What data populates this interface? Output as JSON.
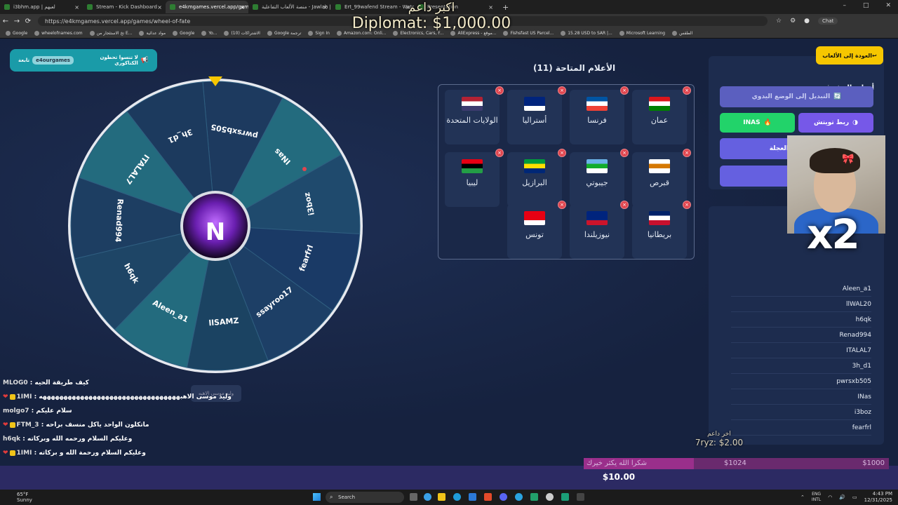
{
  "browser": {
    "tabs": [
      {
        "title": "i3bhm.app | لعبهم",
        "active": false
      },
      {
        "title": "Stream - Kick Dashboard",
        "active": false
      },
      {
        "title": "e4kmgames.vercel.app/games/wh...",
        "active": true
      },
      {
        "title": "منصة الألعاب التفاعلية - Jawlah | جولة",
        "active": false
      },
      {
        "title": "Ert_99wafend Stream - Watch L...",
        "active": false
      },
      {
        "title": "Presentation",
        "active": false
      }
    ],
    "new_tab": "+",
    "url": "https://e4kmgames.vercel.app/games/wheel-of-fate",
    "chat_label": "Chat",
    "bookmarks": [
      "Google",
      "wheelofnames.com",
      "تخ الاستئجار من E...",
      "مواد عدائية",
      "Google",
      "Yo...",
      "(10) الاشتراكات",
      "Google ترجمة",
      "Sign In",
      "Amazon.com: Onli...",
      "Electronics, Cars, F...",
      "AliExpress - موقع...",
      "Fishsfast US Parcel...",
      "15.28 USD to SAR |...",
      "Microsoft Learning",
      "الطقس"
    ]
  },
  "overlay": {
    "donor_line1": "اكبر داعم",
    "donor_line2": "Diplomat: $1,000.00",
    "x2": "x2",
    "last_donor_label": "اخر داعم",
    "last_donor_value": "7ryz: $2.00",
    "goal_left_text": "شكرا الله يكثر خيرك",
    "goal_mid": "$1024",
    "goal_right": "$1000",
    "goal_fill_fraction": 0.36,
    "total": "$10.00"
  },
  "notice": {
    "text": "لا تنسوا تحطون الكتاكوري",
    "chip": "e4ourgames",
    "suffix": "تابعة"
  },
  "wheel": {
    "segments": [
      "pwrsxb505",
      "INas",
      "i3boz",
      "fearfrl",
      "ssayroo17",
      "llSAMZ",
      "Aleen_a1",
      "h6qk",
      "Renad994",
      "ITALAL7",
      "3h_d1"
    ],
    "colors": [
      "#1d3a5f",
      "#236b7e",
      "#1f4a6d",
      "#1a3a66",
      "#1d3f66",
      "#1b4362",
      "#236b7e",
      "#1e4566",
      "#1d3e62",
      "#236b7e",
      "#1c3a5e"
    ],
    "center_letter": "N"
  },
  "flags": {
    "title": "الأعلام المتاحة (11)",
    "items": [
      {
        "name": "عمان",
        "colors": [
          "#db161b",
          "#ffffff",
          "#008000"
        ]
      },
      {
        "name": "فرنسا",
        "colors": [
          "#0055a4",
          "#ffffff",
          "#ef4135"
        ]
      },
      {
        "name": "أستراليا",
        "colors": [
          "#00247d",
          "#00247d",
          "#ffffff"
        ]
      },
      {
        "name": "الولايات المتحدة",
        "colors": [
          "#b22234",
          "#ffffff",
          "#3c3b6e"
        ]
      },
      {
        "name": "قبرص",
        "colors": [
          "#ffffff",
          "#d57800",
          "#ffffff"
        ]
      },
      {
        "name": "جيبوتي",
        "colors": [
          "#6ab2e7",
          "#12ad2b",
          "#ffffff"
        ]
      },
      {
        "name": "البرازيل",
        "colors": [
          "#009c3b",
          "#ffdf00",
          "#002776"
        ]
      },
      {
        "name": "ليبيا",
        "colors": [
          "#e70013",
          "#000000",
          "#239e46"
        ]
      },
      {
        "name": "بريطانيا",
        "colors": [
          "#012169",
          "#ffffff",
          "#c8102e"
        ]
      },
      {
        "name": "نيوزيلندا",
        "colors": [
          "#00247d",
          "#00247d",
          "#cc142b"
        ]
      },
      {
        "name": "تونس",
        "colors": [
          "#e70013",
          "#e70013",
          "#ffffff"
        ]
      }
    ],
    "remove_symbol": "×"
  },
  "admin": {
    "back": "العودة إلى الألعاب",
    "title": "أدوات المشرف",
    "manual": "التبديل إلى الوضع اليدوي",
    "twitch": "ربط تويتش",
    "kick": "INAS",
    "wheel_settings": "إعدادات العجلة",
    "hidden_button": "..."
  },
  "players": [
    "Aleen_a1",
    "llWAL20",
    "h6qk",
    "Renad994",
    "ITALAL7",
    "3h_d1",
    "pwrsxb505",
    "INas",
    "i3boz",
    "fearfrl"
  ],
  "chat": [
    {
      "user": "MLOG0",
      "msg": "كيف طريقة الحيه"
    },
    {
      "user": "1IMI",
      "msg": "وليد موسى الاهبهههههههههههههههههههههههههههههههههه",
      "badge": true
    },
    {
      "user": "molgo7",
      "msg": "سلام عليكم"
    },
    {
      "user": "FTM_3",
      "msg": "ماتكلون الواحد ياكل منسف براحه",
      "badge": true
    },
    {
      "user": "h6qk",
      "msg": "وعليكم السلام ورحمه الله وبركاته"
    },
    {
      "user": "1IMI",
      "msg": "وعليكم السلام ورحمة الله و بركاته",
      "badge": true
    }
  ],
  "caption": "وليد موسى الاهبه",
  "taskbar": {
    "temp": "65°F",
    "weather": "Sunny",
    "search": "Search",
    "lang1": "ENG",
    "lang2": "INTL",
    "time": "4:43 PM",
    "date": "12/31/2025"
  }
}
